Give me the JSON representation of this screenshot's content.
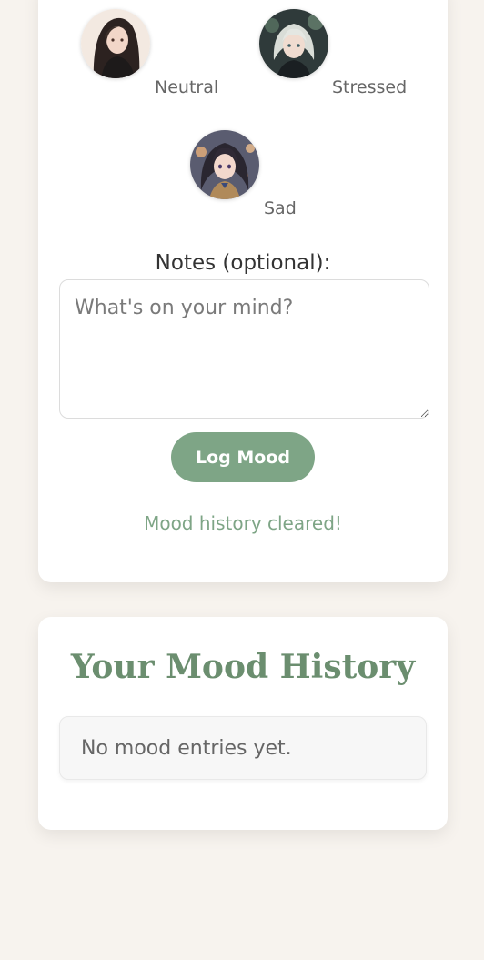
{
  "moods": [
    {
      "label": "Neutral",
      "avatar_icon": "neutral-avatar-icon"
    },
    {
      "label": "Stressed",
      "avatar_icon": "stressed-avatar-icon"
    },
    {
      "label": "Sad",
      "avatar_icon": "sad-avatar-icon"
    }
  ],
  "notes": {
    "label": "Notes (optional):",
    "placeholder": "What's on your mind?",
    "value": ""
  },
  "actions": {
    "log_label": "Log Mood"
  },
  "status": {
    "message": "Mood history cleared!"
  },
  "history": {
    "title": "Your Mood History",
    "empty_text": "No mood entries yet."
  },
  "colors": {
    "accent": "#7ea586",
    "title": "#6b8e6f",
    "page_bg": "#f7f3ee"
  }
}
